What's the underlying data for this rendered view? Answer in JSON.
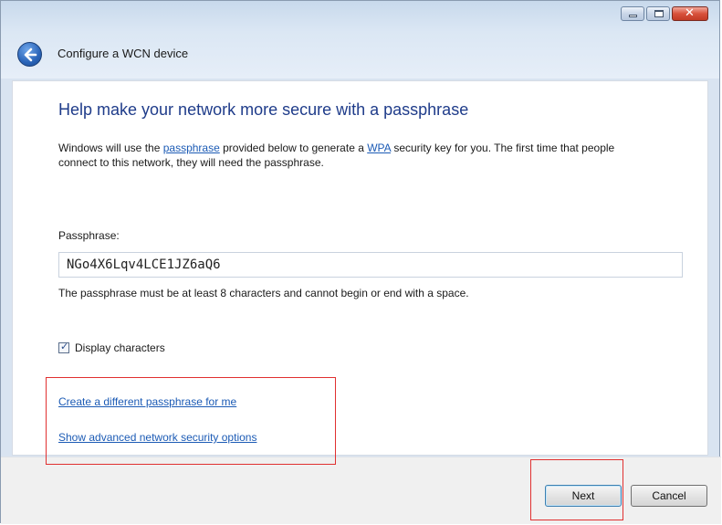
{
  "window": {
    "title": "Configure a WCN device",
    "caption_buttons": [
      "minimize-icon",
      "maximize-icon",
      "close-icon"
    ],
    "close_glyph": "✕"
  },
  "main": {
    "heading": "Help make your network more secure with a passphrase",
    "desc_part1": "Windows will use the ",
    "desc_link1": "passphrase",
    "desc_part2": " provided below to generate a ",
    "desc_link2": "WPA",
    "desc_part3": " security key for you. The first time that people connect to this network, they will need the passphrase.",
    "passphrase_label": "Passphrase:",
    "passphrase_value": "NGo4X6Lqv4LCE1JZ6aQ6",
    "hint": "The passphrase must be at least 8 characters and cannot begin or end with a space.",
    "checkbox_label": "Display characters",
    "checkbox_checked": true,
    "link_create": "Create a different passphrase for me",
    "link_advanced": "Show advanced network security options"
  },
  "footer": {
    "next_label": "Next",
    "cancel_label": "Cancel"
  },
  "colors": {
    "heading": "#1f3c8a",
    "link": "#1c5bb5",
    "highlight_box": "#e03030"
  }
}
